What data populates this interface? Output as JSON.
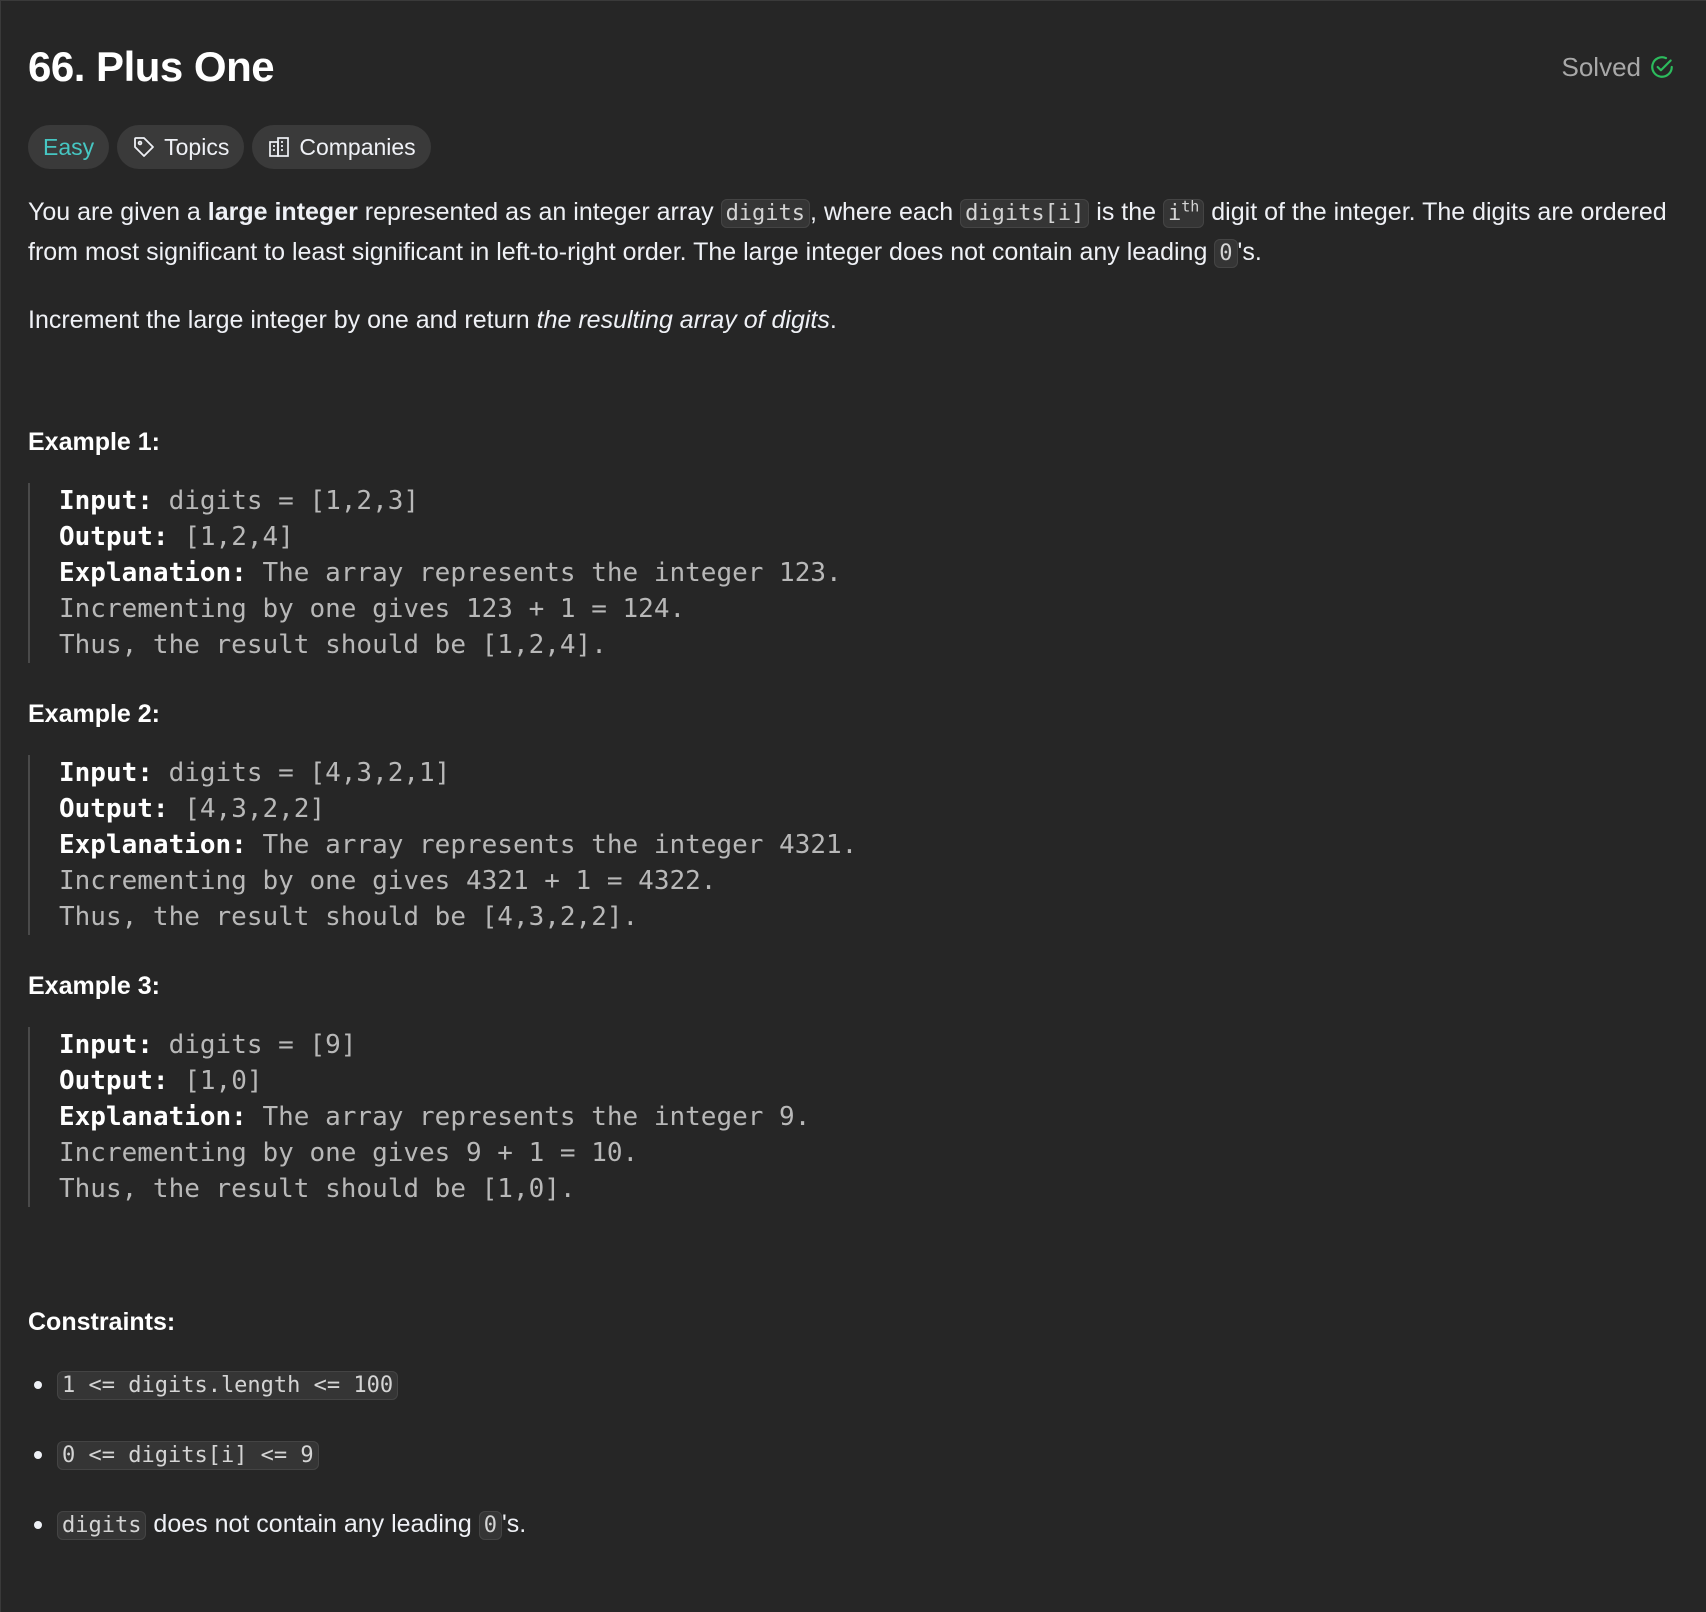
{
  "problem": {
    "title": "66. Plus One",
    "status": "Solved",
    "difficulty": "Easy",
    "tags": {
      "topics": "Topics",
      "companies": "Companies"
    }
  },
  "description": {
    "p1": {
      "t1": "You are given a ",
      "b1": "large integer",
      "t2": " represented as an integer array ",
      "c1": "digits",
      "t3": ", where each ",
      "c2": "digits[i]",
      "t4": " is the ",
      "c3": "i",
      "c3sup": "th",
      "t5": " digit of the integer. The digits are ordered from most significant to least significant in left-to-right order. The large integer does not contain any leading ",
      "c4": "0",
      "t6": "'s."
    },
    "p2": {
      "t1": "Increment the large integer by one and return ",
      "i1": "the resulting array of digits",
      "t2": "."
    }
  },
  "examples": [
    {
      "title": "Example 1:",
      "input_label": "Input:",
      "input": " digits = [1,2,3]",
      "output_label": "Output:",
      "output": " [1,2,4]",
      "explanation_label": "Explanation:",
      "explanation_1": " The array represents the integer 123.",
      "explanation_2": "Incrementing by one gives 123 + 1 = 124.",
      "explanation_3": "Thus, the result should be [1,2,4]."
    },
    {
      "title": "Example 2:",
      "input_label": "Input:",
      "input": " digits = [4,3,2,1]",
      "output_label": "Output:",
      "output": " [4,3,2,2]",
      "explanation_label": "Explanation:",
      "explanation_1": " The array represents the integer 4321.",
      "explanation_2": "Incrementing by one gives 4321 + 1 = 4322.",
      "explanation_3": "Thus, the result should be [4,3,2,2]."
    },
    {
      "title": "Example 3:",
      "input_label": "Input:",
      "input": " digits = [9]",
      "output_label": "Output:",
      "output": " [1,0]",
      "explanation_label": "Explanation:",
      "explanation_1": " The array represents the integer 9.",
      "explanation_2": "Incrementing by one gives 9 + 1 = 10.",
      "explanation_3": "Thus, the result should be [1,0]."
    }
  ],
  "constraints": {
    "title": "Constraints:",
    "c1": "1 <= digits.length <= 100",
    "c2": "0 <= digits[i] <= 9",
    "c3_code": "digits",
    "c3_text": " does not contain any leading ",
    "c3_code2": "0",
    "c3_tail": "'s."
  },
  "colors": {
    "background": "#262626",
    "easy": "#46c6c2",
    "solved_check": "#2cbb5d"
  }
}
